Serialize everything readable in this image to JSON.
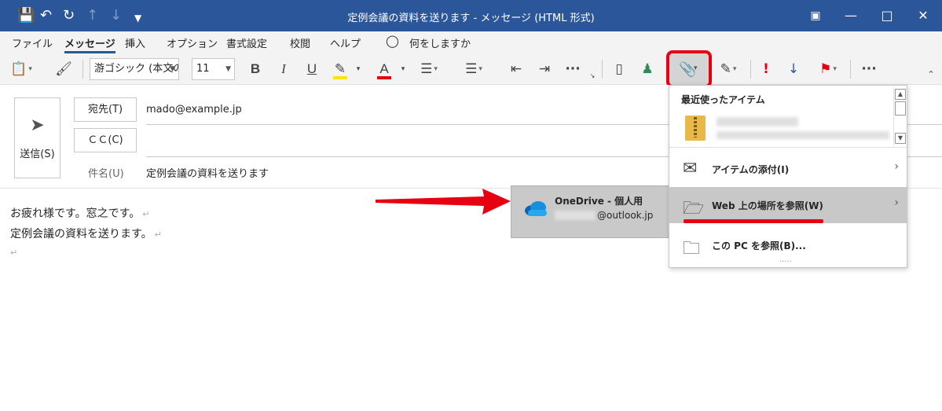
{
  "window": {
    "title": "定例会議の資料を送ります  -  メッセージ (HTML 形式)",
    "titlebar_icons": [
      "save-icon",
      "undo-icon",
      "redo-icon",
      "up-arrow-icon",
      "down-arrow-icon",
      "customize-icon"
    ]
  },
  "menu": {
    "tabs": [
      "ファイル",
      "メッセージ",
      "挿入",
      "オプション",
      "書式設定",
      "校閲",
      "ヘルプ"
    ],
    "active_tab": "メッセージ",
    "search_label": "何をしますか"
  },
  "ribbon": {
    "font_name": "游ゴシック (本文の",
    "font_size": "11",
    "bold": "B",
    "italic": "I",
    "underline": "U",
    "more": "···",
    "important": "!",
    "highlight_color": "#ffe600",
    "font_color": "#e60012"
  },
  "compose": {
    "send_label": "送信(S)",
    "to_label": "宛先(T)",
    "to_value": "mado@example.jp",
    "cc_label": "ＣＣ(C)",
    "cc_value": "",
    "subject_label": "件名(U)",
    "subject_value": "定例会議の資料を送ります"
  },
  "body": {
    "lines": [
      "お疲れ様です。窓之です。",
      "定例会議の資料を送ります。",
      ""
    ],
    "paragraph_mark": "↵"
  },
  "attach_menu": {
    "recent_header": "最近使ったアイテム",
    "items": [
      {
        "label": "アイテムの添付(I)",
        "icon": "envelope-icon"
      },
      {
        "label": "Web 上の場所を参照(W)",
        "icon": "folder-web-icon"
      },
      {
        "label": "この PC を参照(B)...",
        "icon": "folder-icon"
      }
    ],
    "highlighted_item": "Web 上の場所を参照(W)"
  },
  "onedrive": {
    "title": "OneDrive - 個人用",
    "email_suffix": "@outlook.jp"
  },
  "colors": {
    "accent": "#2b579a",
    "annotation_red": "#e60012",
    "menu_hover": "#c8c8c8"
  }
}
